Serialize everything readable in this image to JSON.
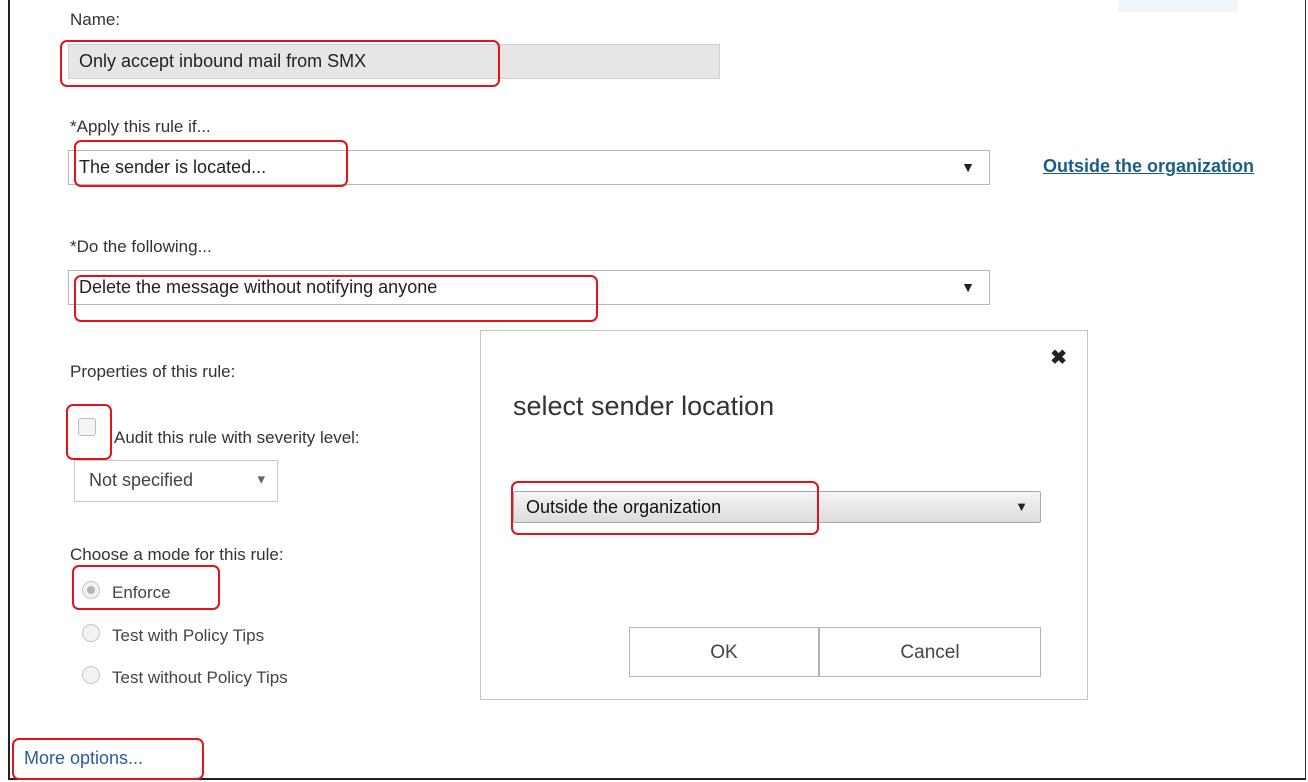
{
  "form": {
    "name_label": "Name:",
    "name_value": "Only accept inbound mail from SMX",
    "apply_label": "*Apply this rule if...",
    "apply_value": "The sender is located...",
    "apply_link": "Outside the organization",
    "do_label": "*Do the following...",
    "do_value": "Delete the message without notifying anyone",
    "properties_label": "Properties of this rule:",
    "audit_label": "Audit this rule with severity level:",
    "severity_value": "Not specified",
    "mode_label": "Choose a mode for this rule:",
    "modes": [
      "Enforce",
      "Test with Policy Tips",
      "Test without Policy Tips"
    ],
    "selected_mode": "Enforce",
    "more_options": "More options..."
  },
  "dialog": {
    "title": "select sender location",
    "select_value": "Outside the organization",
    "ok_label": "OK",
    "cancel_label": "Cancel",
    "close_glyph": "✖"
  },
  "glyphs": {
    "dropdown_arrow": "▼",
    "small_arrow": "▾"
  },
  "colors": {
    "highlight": "#e0141b",
    "link": "#1a5e86"
  }
}
